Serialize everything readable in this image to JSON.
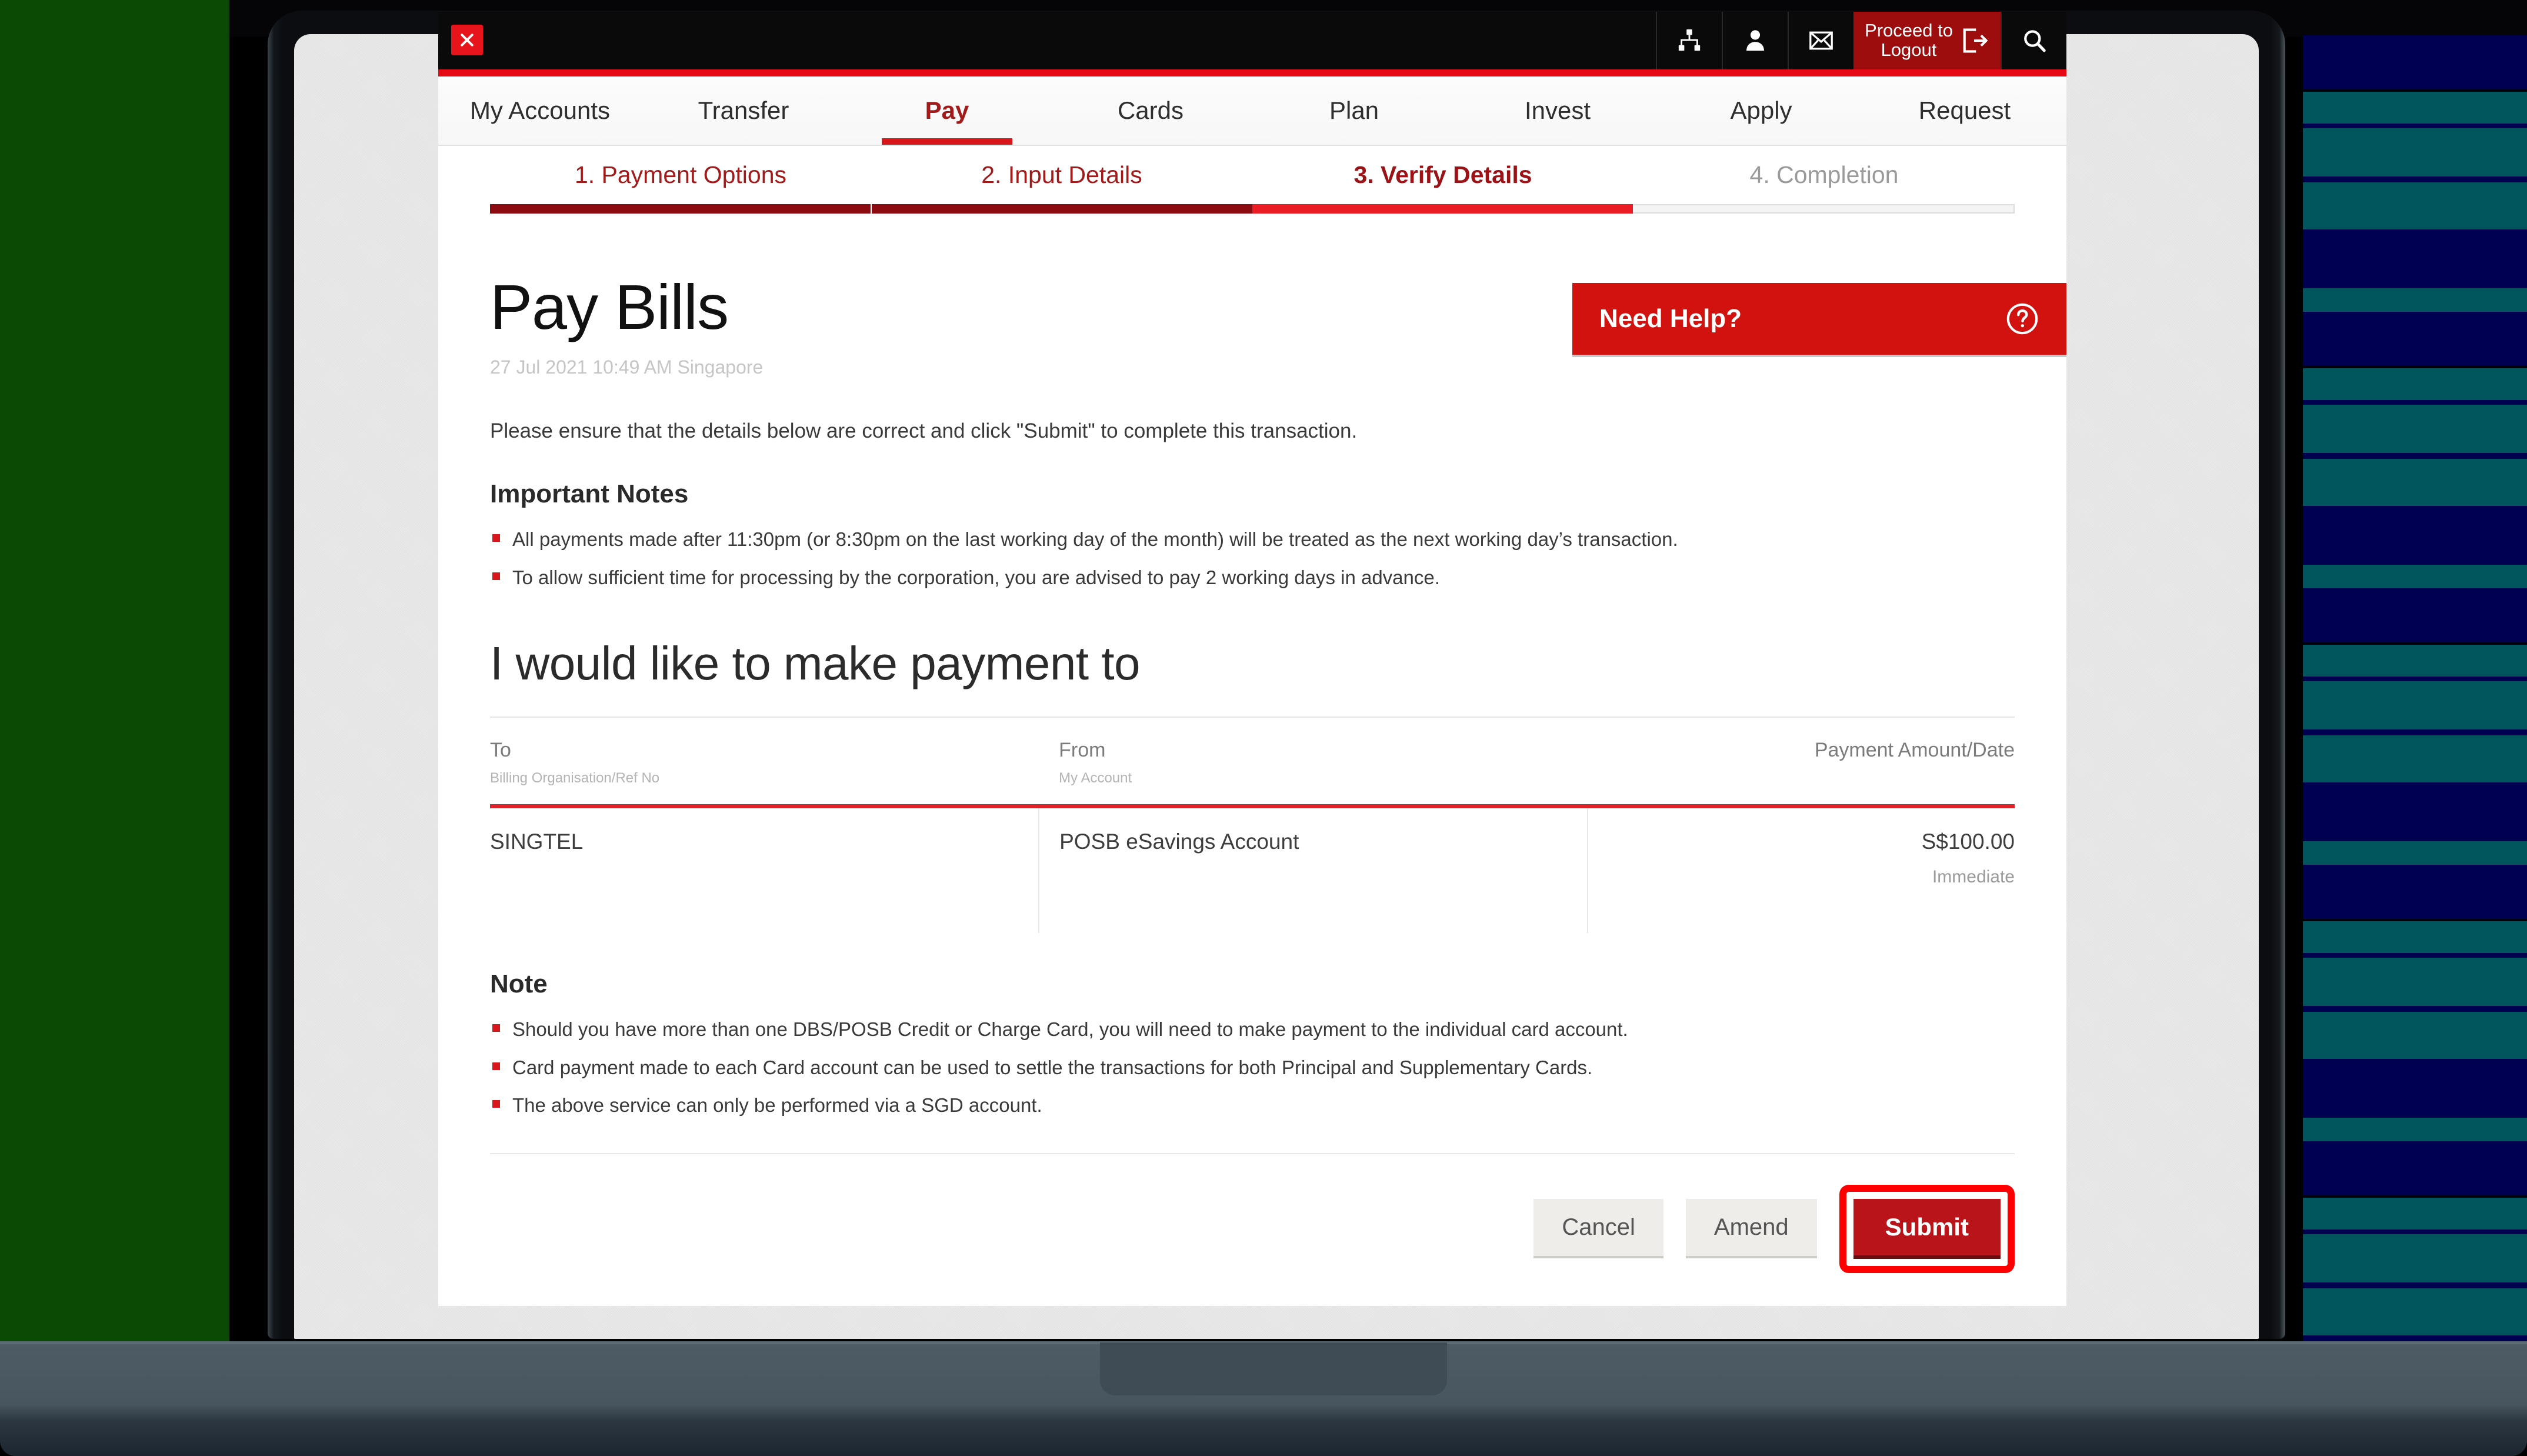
{
  "topbar": {
    "close_icon": "close-x-icon",
    "icons": [
      {
        "name": "sitemap-icon",
        "label": "Sitemap"
      },
      {
        "name": "person-icon",
        "label": "Profile"
      },
      {
        "name": "envelope-icon",
        "label": "Messages"
      }
    ],
    "logout_label": "Proceed to\nLogout",
    "logout_line1": "Proceed to",
    "logout_line2": "Logout",
    "logout_icon": "exit-door-icon",
    "search_icon": "search-icon"
  },
  "nav": {
    "tabs": [
      {
        "label": "My Accounts",
        "active": false
      },
      {
        "label": "Transfer",
        "active": false
      },
      {
        "label": "Pay",
        "active": true
      },
      {
        "label": "Cards",
        "active": false
      },
      {
        "label": "Plan",
        "active": false
      },
      {
        "label": "Invest",
        "active": false
      },
      {
        "label": "Apply",
        "active": false
      },
      {
        "label": "Request",
        "active": false
      }
    ]
  },
  "steps": [
    {
      "label": "1. Payment Options",
      "state": "done"
    },
    {
      "label": "2. Input Details",
      "state": "done"
    },
    {
      "label": "3. Verify Details",
      "state": "current"
    },
    {
      "label": "4. Completion",
      "state": "pending"
    }
  ],
  "page": {
    "title": "Pay Bills",
    "timestamp": "27 Jul 2021 10:49 AM Singapore",
    "intro": "Please ensure that the details below are correct and click \"Submit\" to complete this transaction.",
    "important_notes_heading": "Important Notes",
    "important_notes": [
      "All payments made after 11:30pm (or 8:30pm on the last working day of the month) will be treated as the next working day’s transaction.",
      "To allow sufficient time for processing by the corporation, you are advised to pay 2 working days in advance."
    ],
    "payment_heading": "I would like to make payment to",
    "note_heading": "Note",
    "notes": [
      "Should you have more than one DBS/POSB Credit or Charge Card, you will need to make payment to the individual card account.",
      "Card payment made to each Card account can be used to settle the transactions for both Principal and Supplementary Cards.",
      "The above service can only be performed via a SGD account."
    ]
  },
  "need_help": {
    "label": "Need Help?",
    "icon": "question-circle-icon"
  },
  "table": {
    "headers": [
      {
        "main": "To",
        "sub": "Billing Organisation/Ref No"
      },
      {
        "main": "From",
        "sub": "My Account"
      },
      {
        "main": "Payment Amount/Date",
        "sub": ""
      }
    ],
    "rows": [
      {
        "to": "SINGTEL",
        "from": "POSB eSavings Account",
        "amount": "S$100.00",
        "date": "Immediate"
      }
    ]
  },
  "actions": {
    "cancel": "Cancel",
    "amend": "Amend",
    "submit": "Submit"
  },
  "colors": {
    "brand_red": "#d8161b",
    "dark_red": "#8c0b10",
    "current_red": "#ec1c24",
    "highlight_red": "#fe0000",
    "logout_red": "#9e0d0d",
    "help_red": "#d1120f",
    "bg_green": "#0a4a05",
    "bg_navy": "#000050",
    "bg_teal": "#00565c"
  }
}
